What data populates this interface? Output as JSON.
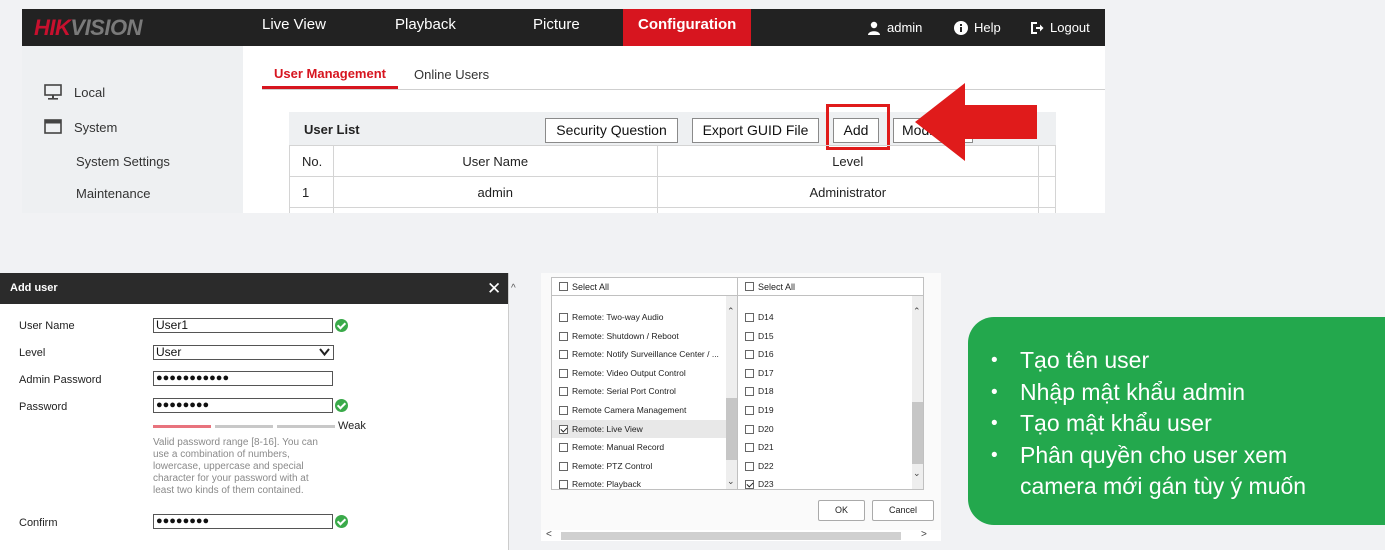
{
  "nav": {
    "logo": "HIKVISION",
    "items": [
      "Live View",
      "Playback",
      "Picture",
      "Configuration"
    ],
    "active": "Configuration",
    "user": "admin",
    "help": "Help",
    "logout": "Logout"
  },
  "sidebar": {
    "items": [
      "Local",
      "System",
      "System Settings",
      "Maintenance"
    ]
  },
  "tabs": [
    "User Management",
    "Online Users"
  ],
  "user_list": {
    "title": "User List",
    "buttons": [
      "Security Question",
      "Export GUID File",
      "Add",
      "Modi"
    ],
    "columns": [
      "No.",
      "User Name",
      "Level"
    ],
    "rows": [
      [
        "1",
        "admin",
        "Administrator"
      ]
    ]
  },
  "dialog": {
    "title": "Add user",
    "close": "✕",
    "labels": {
      "user_name": "User Name",
      "level": "Level",
      "admin_password": "Admin Password",
      "password": "Password",
      "confirm": "Confirm"
    },
    "values": {
      "user_name": "User1",
      "level": "User",
      "admin_password": "●●●●●●●●●●●",
      "password": "●●●●●●●●",
      "confirm": "●●●●●●●●"
    },
    "strength": "Weak",
    "hint": "Valid password range [8-16]. You can use a combination of numbers, lowercase, uppercase and special character for your password with at least two kinds of them contained."
  },
  "permissions": {
    "select_all_left": "Select All",
    "select_all_right": "Select All",
    "left_items": [
      {
        "label": "Remote: Two-way Audio",
        "checked": false
      },
      {
        "label": "Remote: Shutdown / Reboot",
        "checked": false
      },
      {
        "label": "Remote: Notify Surveillance Center / ...",
        "checked": false
      },
      {
        "label": "Remote: Video Output Control",
        "checked": false
      },
      {
        "label": "Remote: Serial Port Control",
        "checked": false
      },
      {
        "label": "Remote Camera Management",
        "checked": false
      },
      {
        "label": "Remote: Live View",
        "checked": true
      },
      {
        "label": "Remote: Manual Record",
        "checked": false
      },
      {
        "label": "Remote: PTZ Control",
        "checked": false
      },
      {
        "label": "Remote: Playback",
        "checked": false
      }
    ],
    "right_items": [
      {
        "label": "D14",
        "checked": false
      },
      {
        "label": "D15",
        "checked": false
      },
      {
        "label": "D16",
        "checked": false
      },
      {
        "label": "D17",
        "checked": false
      },
      {
        "label": "D18",
        "checked": false
      },
      {
        "label": "D19",
        "checked": false
      },
      {
        "label": "D20",
        "checked": false
      },
      {
        "label": "D21",
        "checked": false
      },
      {
        "label": "D22",
        "checked": false
      },
      {
        "label": "D23",
        "checked": true
      }
    ],
    "ok": "OK",
    "cancel": "Cancel"
  },
  "info": {
    "bullets": [
      "Tạo tên user",
      "Nhập mật khẩu admin",
      "Tạo mật khẩu user",
      "Phân quyền cho user xem camera mới gán tùy ý muốn"
    ]
  },
  "colors": {
    "accent": "#d7151f",
    "navbar": "#222222",
    "green": "#23a84d",
    "arrow": "#e01b1b"
  }
}
